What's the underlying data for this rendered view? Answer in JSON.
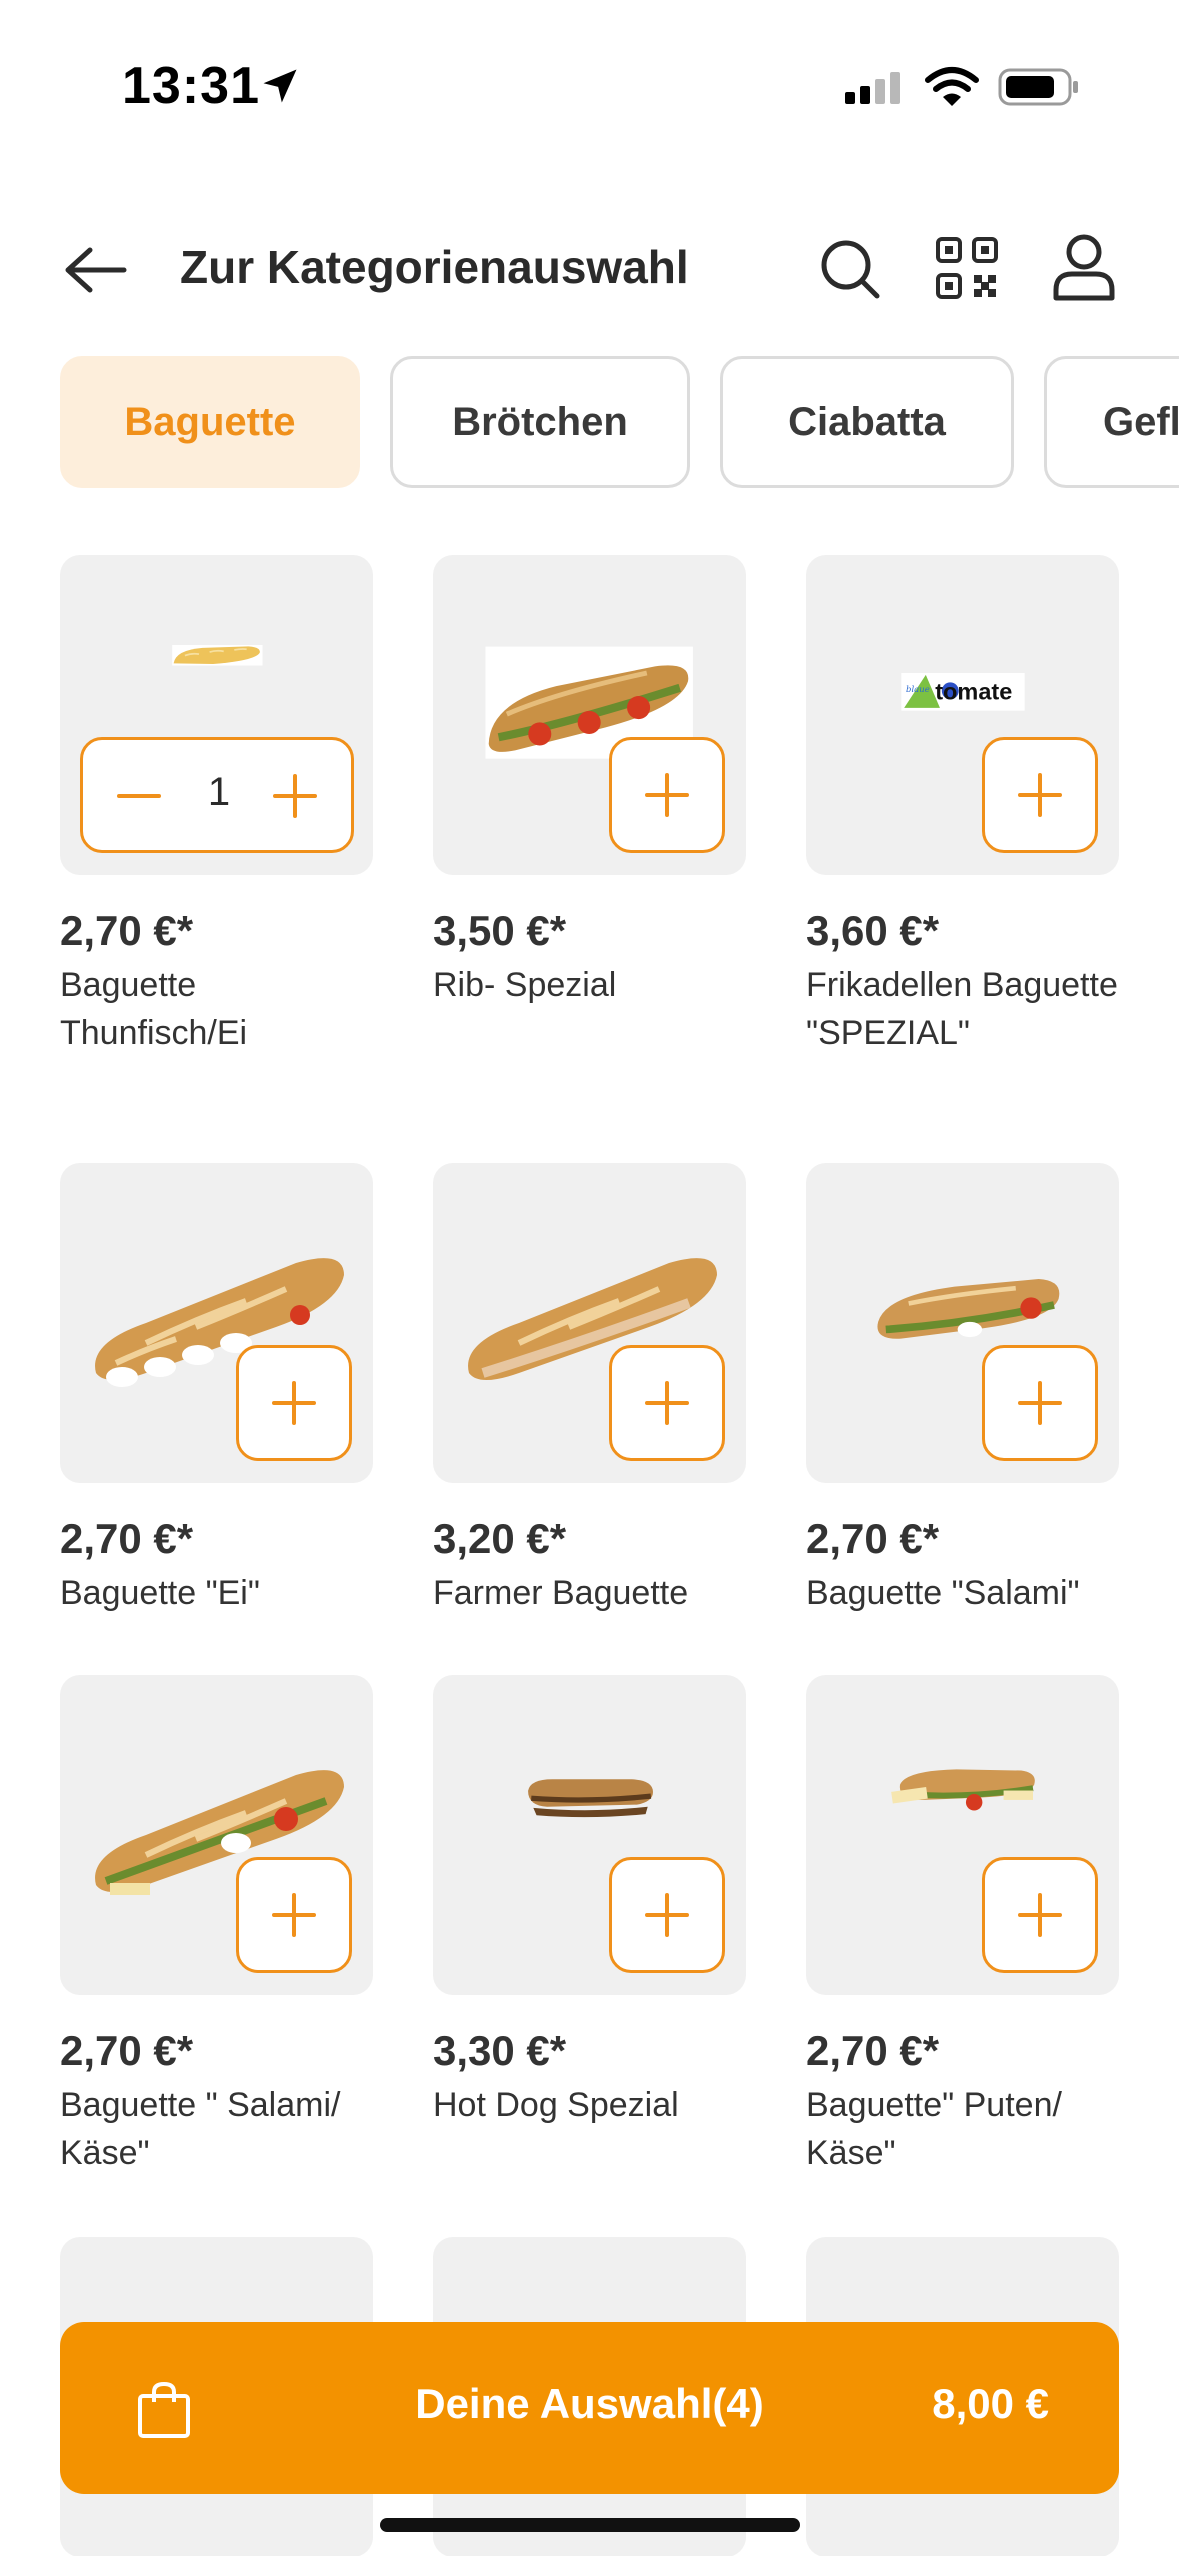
{
  "status": {
    "time": "13:31"
  },
  "header": {
    "title": "Zur Kategorienauswahl"
  },
  "categories": [
    {
      "label": "Baguette",
      "active": true
    },
    {
      "label": "Brötchen",
      "active": false
    },
    {
      "label": "Ciabatta",
      "active": false
    },
    {
      "label": "Gefl",
      "active": false
    }
  ],
  "products": [
    {
      "price": "2,70 €*",
      "name": "Baguette Thunfisch/Ei",
      "qty": "1"
    },
    {
      "price": "3,50 €*",
      "name": "Rib- Spezial"
    },
    {
      "price": "3,60 €*",
      "name": "Frikadellen Baguette \"SPEZIAL\"",
      "logo_text_a": "blaue",
      "logo_text_b": "tomate"
    },
    {
      "price": "2,70 €*",
      "name": "Baguette \"Ei\""
    },
    {
      "price": "3,20 €*",
      "name": "Farmer Baguette"
    },
    {
      "price": "2,70 €*",
      "name": "Baguette \"Salami\""
    },
    {
      "price": "2,70 €*",
      "name": "Baguette \" Salami/ Käse\""
    },
    {
      "price": "3,30 €*",
      "name": "Hot Dog Spezial"
    },
    {
      "price": "2,70 €*",
      "name": "Baguette\" Puten/ Käse\""
    }
  ],
  "cart": {
    "label": "Deine Auswahl(4)",
    "total": "8,00 €"
  },
  "colors": {
    "accent": "#f39200",
    "chip_active_bg": "#fdeedb",
    "card_bg": "#f0f0f0"
  },
  "icons": [
    "location-arrow-icon",
    "signal-icon",
    "wifi-icon",
    "battery-icon",
    "back-arrow-icon",
    "search-icon",
    "qr-code-icon",
    "user-icon",
    "plus-icon",
    "minus-icon",
    "shopping-bag-icon"
  ]
}
